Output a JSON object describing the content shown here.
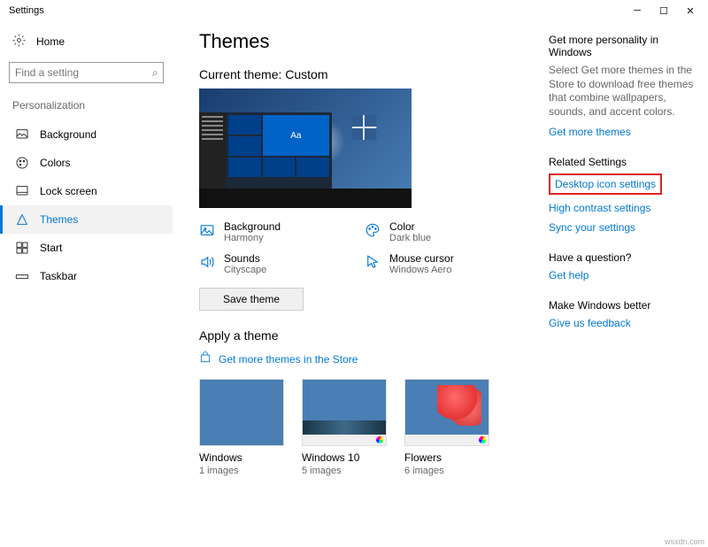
{
  "window": {
    "title": "Settings"
  },
  "sidebar": {
    "home": "Home",
    "search_placeholder": "Find a setting",
    "section_label": "Personalization",
    "items": [
      {
        "label": "Background"
      },
      {
        "label": "Colors"
      },
      {
        "label": "Lock screen"
      },
      {
        "label": "Themes"
      },
      {
        "label": "Start"
      },
      {
        "label": "Taskbar"
      }
    ]
  },
  "main": {
    "title": "Themes",
    "current_theme_label": "Current theme: Custom",
    "settings": {
      "background": {
        "label": "Background",
        "value": "Harmony"
      },
      "color": {
        "label": "Color",
        "value": "Dark blue"
      },
      "sounds": {
        "label": "Sounds",
        "value": "Cityscape"
      },
      "cursor": {
        "label": "Mouse cursor",
        "value": "Windows Aero"
      }
    },
    "save_button": "Save theme",
    "apply_heading": "Apply a theme",
    "store_link": "Get more themes in the Store",
    "themes": [
      {
        "name": "Windows",
        "sub": "1 images"
      },
      {
        "name": "Windows 10",
        "sub": "5 images"
      },
      {
        "name": "Flowers",
        "sub": "6 images"
      }
    ]
  },
  "right": {
    "personality": {
      "head": "Get more personality in Windows",
      "text": "Select Get more themes in the Store to download free themes that combine wallpapers, sounds, and accent colors.",
      "link": "Get more themes"
    },
    "related": {
      "head": "Related Settings",
      "links": [
        "Desktop icon settings",
        "High contrast settings",
        "Sync your settings"
      ]
    },
    "question": {
      "head": "Have a question?",
      "link": "Get help"
    },
    "better": {
      "head": "Make Windows better",
      "link": "Give us feedback"
    }
  },
  "watermark": "wsxdn.com"
}
